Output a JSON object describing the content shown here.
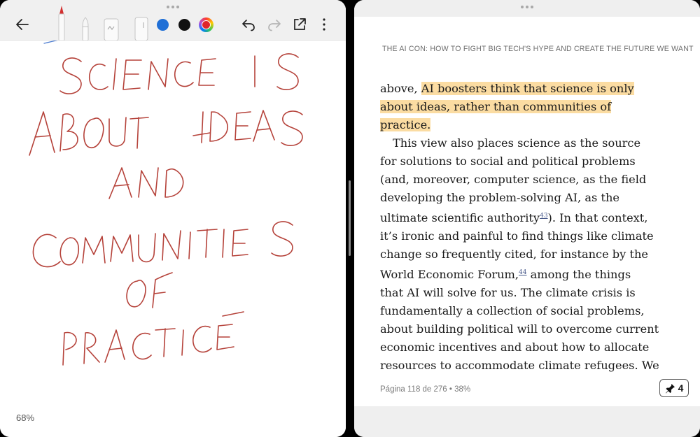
{
  "notes_app": {
    "toolbar": {
      "back_icon": "arrow-left-icon",
      "tools": [
        "red-pen",
        "fountain-pen",
        "marker",
        "eraser"
      ],
      "colors": {
        "blue": "#1f6fd6",
        "black": "#111111",
        "red": "#e0262b"
      },
      "undo_icon": "undo-icon",
      "redo_icon": "redo-icon",
      "share_icon": "share-icon",
      "more_icon": "more-vertical-icon"
    },
    "canvas": {
      "ink_color": "#b5423a",
      "handwriting_lines": [
        "SCIENCE IS",
        "ABOUT IDEAS",
        "AND",
        "COMMUNITIES",
        "OF",
        "PRACTICE"
      ]
    },
    "zoom": "68%"
  },
  "reader_app": {
    "book_title": "THE AI CON: HOW TO FIGHT BIG TECH'S HYPE AND CREATE THE FUTURE WE WANT",
    "highlight_color": "#fbdca2",
    "text": {
      "l1_plain": "above, ",
      "l1_hl": "AI boosters think that science is only",
      "l2_hl": "about ideas, rather than communities of",
      "l3_hl": "practice.",
      "l4": "This view also places science as the source",
      "l5": "for solutions to social and political problems",
      "l6": "(and, moreover, computer science, as the field",
      "l7": "developing the problem-solving AI, as the",
      "l8_a": "ultimate scientific authority",
      "fn_43": "43",
      "l8_b": "). In that context,",
      "l9": "it’s ironic and painful to find things like climate",
      "l10": "change so frequently cited, for instance by the",
      "l11_a": "World Economic Forum,",
      "fn_44": "44",
      "l11_b": " among the things",
      "l12": "that AI will solve for us. The climate crisis is",
      "l13": "fundamentally a collection of social problems,",
      "l14": "about building political will to overcome current",
      "l15": "economic incentives and about how to allocate",
      "l16": "resources to accommodate climate refugees. We"
    },
    "page_info": "Página 118 de 276 • 38%",
    "pin_count": "4"
  }
}
